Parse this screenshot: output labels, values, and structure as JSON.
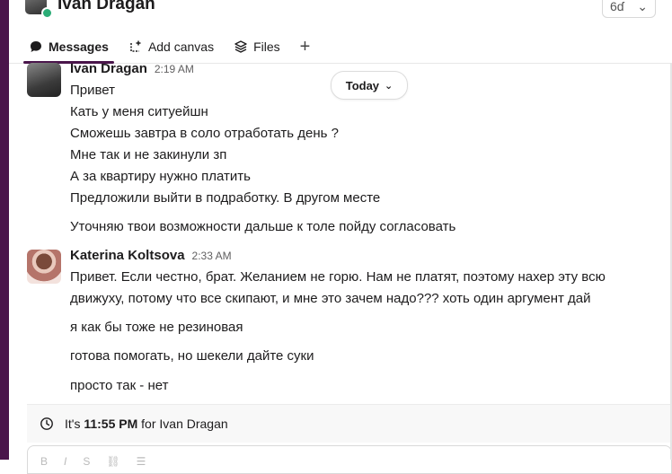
{
  "header": {
    "title": "Ivan Dragan",
    "right_glyph": "6ɗ",
    "right_chevron": "⌄"
  },
  "tabs": [
    {
      "label": "Messages",
      "icon": "messages-icon",
      "active": true
    },
    {
      "label": "Add canvas",
      "icon": "canvas-icon",
      "active": false
    },
    {
      "label": "Files",
      "icon": "files-icon",
      "active": false
    },
    {
      "label": "+",
      "icon": "add-tab-icon",
      "active": false
    }
  ],
  "day_divider": {
    "label": "Today",
    "chevron": "⌄"
  },
  "messages": [
    {
      "author": "Ivan Dragan",
      "time": "2:19 AM",
      "lines": [
        "Привет",
        "Кать у меня ситуейшн",
        "Сможешь завтра в соло отработать день ?",
        "Мне так и не закинули зп",
        "А за квартиру нужно платить",
        "Предложили выйти в подработку. В другом месте",
        "Уточняю твои возможности дальше к толе пойду согласовать"
      ]
    },
    {
      "author": "Katerina Koltsova",
      "time": "2:33 AM",
      "lines": [
        "Привет. Если честно, брат. Желанием не горю. Нам не платят, поэтому нахер эту всю",
        "движуху, потому что все скипают, и мне это зачем надо??? хоть один аргумент дай",
        "я как бы тоже не резиновая",
        "готова помогать, но шекели дайте суки",
        "просто так - нет"
      ]
    }
  ],
  "local_time": {
    "prefix": "It's",
    "time": "11:55 PM",
    "suffix": "for Ivan Dragan"
  },
  "colors": {
    "accent": "#4a154b",
    "presence": "#2bac76"
  }
}
